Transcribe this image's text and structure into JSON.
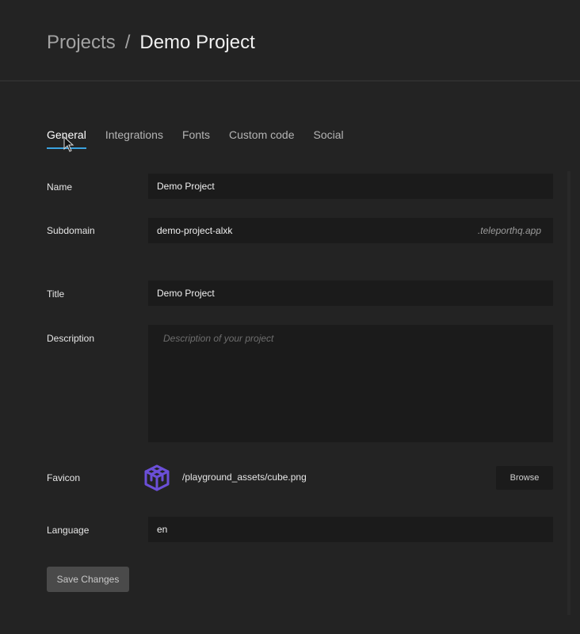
{
  "breadcrumb": {
    "parent": "Projects",
    "separator": "/",
    "current": "Demo Project"
  },
  "tabs": [
    {
      "label": "General",
      "active": true
    },
    {
      "label": "Integrations",
      "active": false
    },
    {
      "label": "Fonts",
      "active": false
    },
    {
      "label": "Custom code",
      "active": false
    },
    {
      "label": "Social",
      "active": false
    }
  ],
  "form": {
    "name": {
      "label": "Name",
      "value": "Demo Project"
    },
    "subdomain": {
      "label": "Subdomain",
      "value": "demo-project-alxk",
      "suffix": ".teleporthq.app"
    },
    "title": {
      "label": "Title",
      "value": "Demo Project"
    },
    "description": {
      "label": "Description",
      "value": "",
      "placeholder": "Description of your project"
    },
    "favicon": {
      "label": "Favicon",
      "path": "/playground_assets/cube.png",
      "browse_label": "Browse",
      "icon": "cube-icon"
    },
    "language": {
      "label": "Language",
      "value": "en"
    }
  },
  "actions": {
    "save_label": "Save Changes"
  },
  "colors": {
    "background": "#232323",
    "field_background": "#1b1b1b",
    "active_tab_underline": "#3ba3e0",
    "favicon_purple": "#6b4fd8"
  }
}
